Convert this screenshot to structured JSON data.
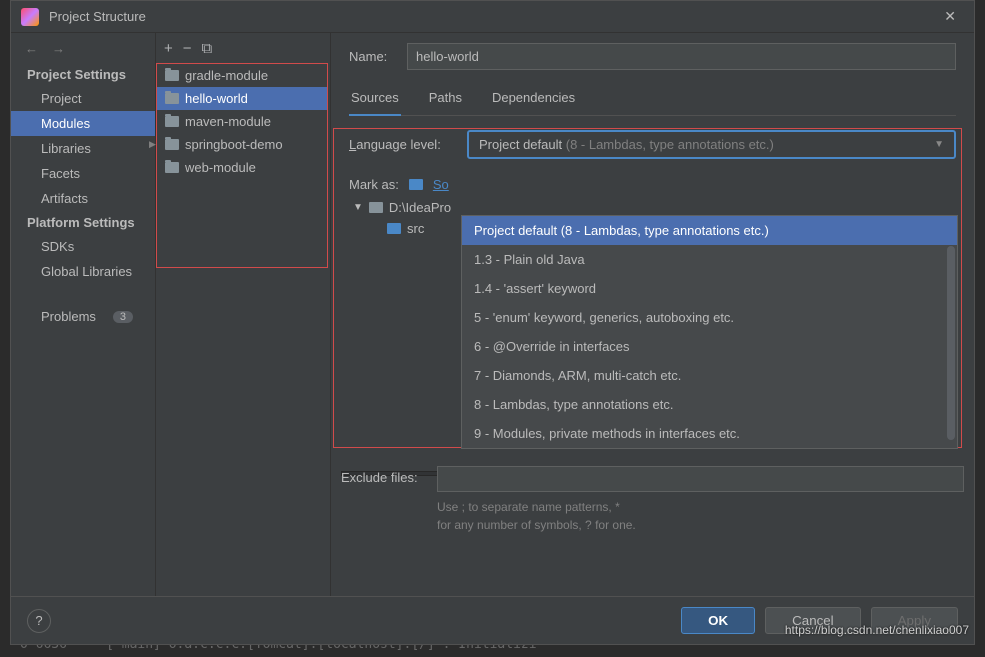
{
  "dialog": {
    "title": "Project Structure"
  },
  "sidebar": {
    "sections": {
      "project": "Project Settings",
      "platform": "Platform Settings"
    },
    "items": {
      "project": "Project",
      "modules": "Modules",
      "libraries": "Libraries",
      "facets": "Facets",
      "artifacts": "Artifacts",
      "sdks": "SDKs",
      "global_libraries": "Global Libraries",
      "problems": "Problems",
      "problems_badge": "3"
    }
  },
  "modules": {
    "items": [
      "gradle-module",
      "hello-world",
      "maven-module",
      "springboot-demo",
      "web-module"
    ]
  },
  "detail": {
    "name_label": "Name:",
    "name_value": "hello-world",
    "tabs": {
      "sources": "Sources",
      "paths": "Paths",
      "dependencies": "Dependencies"
    },
    "language_level_label": "Language level:",
    "dropdown_value": "Project default",
    "dropdown_hint": "(8 - Lambdas, type annotations etc.)",
    "dropdown_options": [
      "Project default (8 - Lambdas, type annotations etc.)",
      "1.3 - Plain old Java",
      "1.4 - 'assert' keyword",
      "5 - 'enum' keyword, generics, autoboxing etc.",
      "6 - @Override in interfaces",
      "7 - Diamonds, ARM, multi-catch etc.",
      "8 - Lambdas, type annotations etc.",
      "9 - Modules, private methods in interfaces etc."
    ],
    "mark_as": "Mark as:",
    "mark_sources": "So",
    "tree_root": "D:\\IdeaPro",
    "tree_src": "src",
    "exclude_label": "Exclude files:",
    "exclude_hint1": "Use ; to separate name patterns, *",
    "exclude_hint2": "for any number of symbols, ? for one."
  },
  "footer": {
    "ok": "OK",
    "cancel": "Cancel",
    "apply": "Apply",
    "help": "?"
  },
  "watermark": "https://blog.csdn.net/chenlixiao007"
}
